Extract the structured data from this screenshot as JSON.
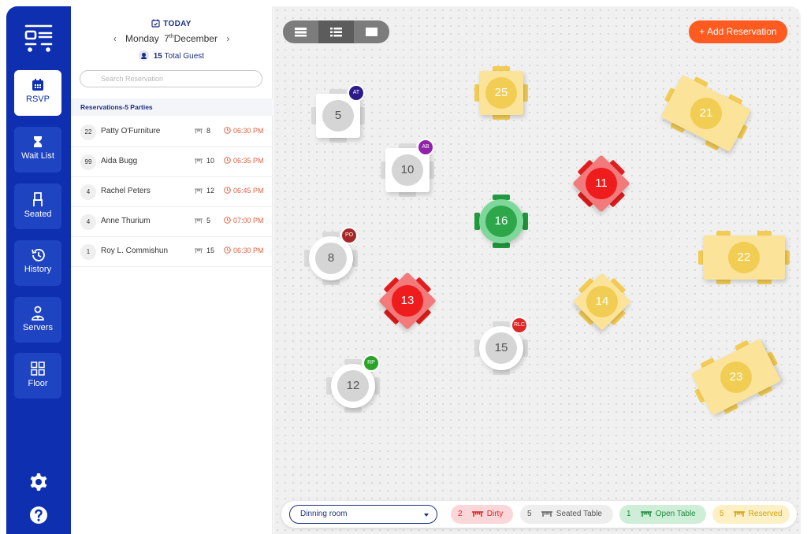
{
  "nav": {
    "items": [
      {
        "label": "RSVP",
        "active": true
      },
      {
        "label": "Wait List",
        "active": false
      },
      {
        "label": "Seated",
        "active": false
      },
      {
        "label": "History",
        "active": false
      },
      {
        "label": "Servers",
        "active": false
      },
      {
        "label": "Floor",
        "active": false
      }
    ]
  },
  "header": {
    "today_label": "TODAY",
    "weekday": "Monday",
    "day": "7",
    "day_suffix": "th",
    "month": "December",
    "guest_count": "15",
    "guest_label": "Total Guest"
  },
  "search": {
    "placeholder": "Search Reservation"
  },
  "reservations": {
    "title": "Reservations-5 Parties",
    "rows": [
      {
        "count": "22",
        "name": "Patty O'Furniture",
        "table": "8",
        "time": "06:30 PM"
      },
      {
        "count": "99",
        "name": "Aida Bugg",
        "table": "10",
        "time": "06:35 PM"
      },
      {
        "count": "4",
        "name": "Rachel Peters",
        "table": "12",
        "time": "06:45 PM"
      },
      {
        "count": "4",
        "name": "Anne Thurium",
        "table": "5",
        "time": "07:00 PM"
      },
      {
        "count": "1",
        "name": "Roy L. Commishun",
        "table": "15",
        "time": "06:30 PM"
      }
    ]
  },
  "floor": {
    "add_button": "+ Add Reservation",
    "tables": [
      {
        "number": "5",
        "status": "seated",
        "shape": "square",
        "server": "AT"
      },
      {
        "number": "25",
        "status": "reserved",
        "shape": "square",
        "server": ""
      },
      {
        "number": "21",
        "status": "reserved",
        "shape": "rect",
        "server": ""
      },
      {
        "number": "10",
        "status": "seated",
        "shape": "square",
        "server": "AB"
      },
      {
        "number": "11",
        "status": "dirty",
        "shape": "diamond",
        "server": ""
      },
      {
        "number": "16",
        "status": "open",
        "shape": "round",
        "server": ""
      },
      {
        "number": "8",
        "status": "seated",
        "shape": "round",
        "server": "PO"
      },
      {
        "number": "22",
        "status": "reserved",
        "shape": "rect",
        "server": ""
      },
      {
        "number": "13",
        "status": "dirty",
        "shape": "diamond",
        "server": ""
      },
      {
        "number": "14",
        "status": "reserved",
        "shape": "diamond",
        "server": ""
      },
      {
        "number": "15",
        "status": "seated",
        "shape": "round",
        "server": "RLC"
      },
      {
        "number": "12",
        "status": "seated",
        "shape": "round",
        "server": "RP"
      },
      {
        "number": "23",
        "status": "reserved",
        "shape": "rect",
        "server": ""
      }
    ]
  },
  "bottom": {
    "room": "Dinning room",
    "legend": [
      {
        "count": "2",
        "label": "Dirty"
      },
      {
        "count": "5",
        "label": "Seated Table"
      },
      {
        "count": "1",
        "label": "Open Table"
      },
      {
        "count": "5",
        "label": "Reserved"
      }
    ]
  },
  "colors": {
    "nav": "#0d2fb0",
    "accent": "#ff5a1f",
    "dirty": "#ee2222",
    "seated": "#ffffff",
    "open": "#2aa14a",
    "reserved": "#f8dc82"
  }
}
